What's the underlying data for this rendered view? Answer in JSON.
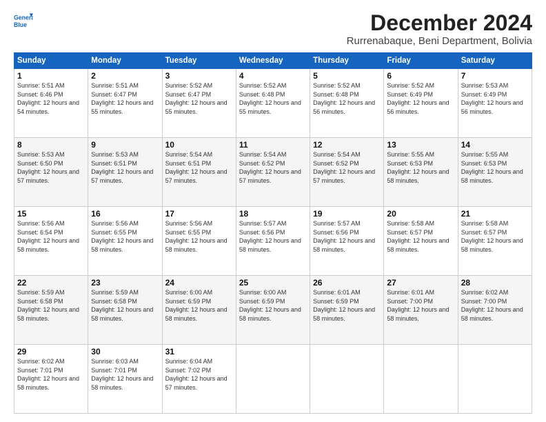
{
  "logo": {
    "line1": "General",
    "line2": "Blue"
  },
  "title": "December 2024",
  "subtitle": "Rurrenabaque, Beni Department, Bolivia",
  "days_header": [
    "Sunday",
    "Monday",
    "Tuesday",
    "Wednesday",
    "Thursday",
    "Friday",
    "Saturday"
  ],
  "weeks": [
    [
      {
        "day": "1",
        "sunrise": "5:51 AM",
        "sunset": "6:46 PM",
        "daylight": "12 hours and 54 minutes."
      },
      {
        "day": "2",
        "sunrise": "5:51 AM",
        "sunset": "6:47 PM",
        "daylight": "12 hours and 55 minutes."
      },
      {
        "day": "3",
        "sunrise": "5:52 AM",
        "sunset": "6:47 PM",
        "daylight": "12 hours and 55 minutes."
      },
      {
        "day": "4",
        "sunrise": "5:52 AM",
        "sunset": "6:48 PM",
        "daylight": "12 hours and 55 minutes."
      },
      {
        "day": "5",
        "sunrise": "5:52 AM",
        "sunset": "6:48 PM",
        "daylight": "12 hours and 56 minutes."
      },
      {
        "day": "6",
        "sunrise": "5:52 AM",
        "sunset": "6:49 PM",
        "daylight": "12 hours and 56 minutes."
      },
      {
        "day": "7",
        "sunrise": "5:53 AM",
        "sunset": "6:49 PM",
        "daylight": "12 hours and 56 minutes."
      }
    ],
    [
      {
        "day": "8",
        "sunrise": "5:53 AM",
        "sunset": "6:50 PM",
        "daylight": "12 hours and 57 minutes."
      },
      {
        "day": "9",
        "sunrise": "5:53 AM",
        "sunset": "6:51 PM",
        "daylight": "12 hours and 57 minutes."
      },
      {
        "day": "10",
        "sunrise": "5:54 AM",
        "sunset": "6:51 PM",
        "daylight": "12 hours and 57 minutes."
      },
      {
        "day": "11",
        "sunrise": "5:54 AM",
        "sunset": "6:52 PM",
        "daylight": "12 hours and 57 minutes."
      },
      {
        "day": "12",
        "sunrise": "5:54 AM",
        "sunset": "6:52 PM",
        "daylight": "12 hours and 57 minutes."
      },
      {
        "day": "13",
        "sunrise": "5:55 AM",
        "sunset": "6:53 PM",
        "daylight": "12 hours and 58 minutes."
      },
      {
        "day": "14",
        "sunrise": "5:55 AM",
        "sunset": "6:53 PM",
        "daylight": "12 hours and 58 minutes."
      }
    ],
    [
      {
        "day": "15",
        "sunrise": "5:56 AM",
        "sunset": "6:54 PM",
        "daylight": "12 hours and 58 minutes."
      },
      {
        "day": "16",
        "sunrise": "5:56 AM",
        "sunset": "6:55 PM",
        "daylight": "12 hours and 58 minutes."
      },
      {
        "day": "17",
        "sunrise": "5:56 AM",
        "sunset": "6:55 PM",
        "daylight": "12 hours and 58 minutes."
      },
      {
        "day": "18",
        "sunrise": "5:57 AM",
        "sunset": "6:56 PM",
        "daylight": "12 hours and 58 minutes."
      },
      {
        "day": "19",
        "sunrise": "5:57 AM",
        "sunset": "6:56 PM",
        "daylight": "12 hours and 58 minutes."
      },
      {
        "day": "20",
        "sunrise": "5:58 AM",
        "sunset": "6:57 PM",
        "daylight": "12 hours and 58 minutes."
      },
      {
        "day": "21",
        "sunrise": "5:58 AM",
        "sunset": "6:57 PM",
        "daylight": "12 hours and 58 minutes."
      }
    ],
    [
      {
        "day": "22",
        "sunrise": "5:59 AM",
        "sunset": "6:58 PM",
        "daylight": "12 hours and 58 minutes."
      },
      {
        "day": "23",
        "sunrise": "5:59 AM",
        "sunset": "6:58 PM",
        "daylight": "12 hours and 58 minutes."
      },
      {
        "day": "24",
        "sunrise": "6:00 AM",
        "sunset": "6:59 PM",
        "daylight": "12 hours and 58 minutes."
      },
      {
        "day": "25",
        "sunrise": "6:00 AM",
        "sunset": "6:59 PM",
        "daylight": "12 hours and 58 minutes."
      },
      {
        "day": "26",
        "sunrise": "6:01 AM",
        "sunset": "6:59 PM",
        "daylight": "12 hours and 58 minutes."
      },
      {
        "day": "27",
        "sunrise": "6:01 AM",
        "sunset": "7:00 PM",
        "daylight": "12 hours and 58 minutes."
      },
      {
        "day": "28",
        "sunrise": "6:02 AM",
        "sunset": "7:00 PM",
        "daylight": "12 hours and 58 minutes."
      }
    ],
    [
      {
        "day": "29",
        "sunrise": "6:02 AM",
        "sunset": "7:01 PM",
        "daylight": "12 hours and 58 minutes."
      },
      {
        "day": "30",
        "sunrise": "6:03 AM",
        "sunset": "7:01 PM",
        "daylight": "12 hours and 58 minutes."
      },
      {
        "day": "31",
        "sunrise": "6:04 AM",
        "sunset": "7:02 PM",
        "daylight": "12 hours and 57 minutes."
      },
      null,
      null,
      null,
      null
    ]
  ]
}
